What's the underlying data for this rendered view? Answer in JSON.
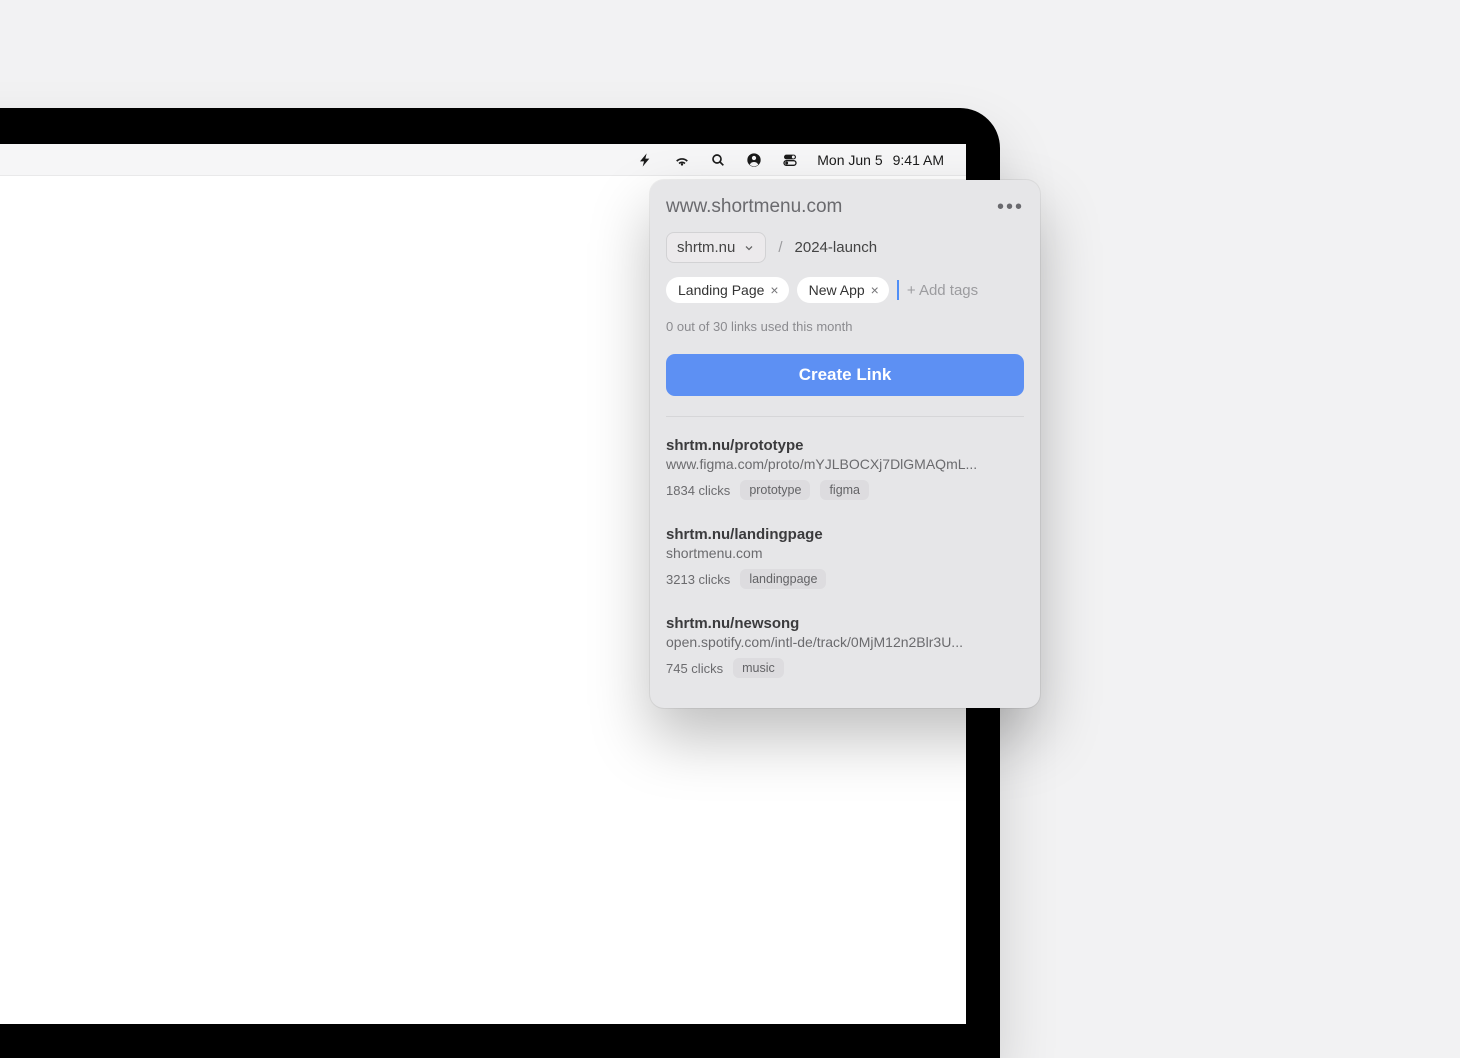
{
  "menubar": {
    "date": "Mon Jun 5",
    "time": "9:41 AM"
  },
  "popover": {
    "title": "www.shortmenu.com",
    "domain": "shrtm.nu",
    "slash": "/",
    "slug": "2024-launch",
    "tags": [
      {
        "label": "Landing Page"
      },
      {
        "label": "New App"
      }
    ],
    "add_tags_placeholder": "+ Add tags",
    "usage": "0 out of 30 links used this month",
    "create_button": "Create Link",
    "links": [
      {
        "short": "shrtm.nu/prototype",
        "long": "www.figma.com/proto/mYJLBOCXj7DlGMAQmL...",
        "clicks": "1834 clicks",
        "chips": [
          "prototype",
          "figma"
        ]
      },
      {
        "short": "shrtm.nu/landingpage",
        "long": "shortmenu.com",
        "clicks": "3213 clicks",
        "chips": [
          "landingpage"
        ]
      },
      {
        "short": "shrtm.nu/newsong",
        "long": "open.spotify.com/intl-de/track/0MjM12n2Blr3U...",
        "clicks": "745 clicks",
        "chips": [
          "music"
        ]
      }
    ]
  }
}
